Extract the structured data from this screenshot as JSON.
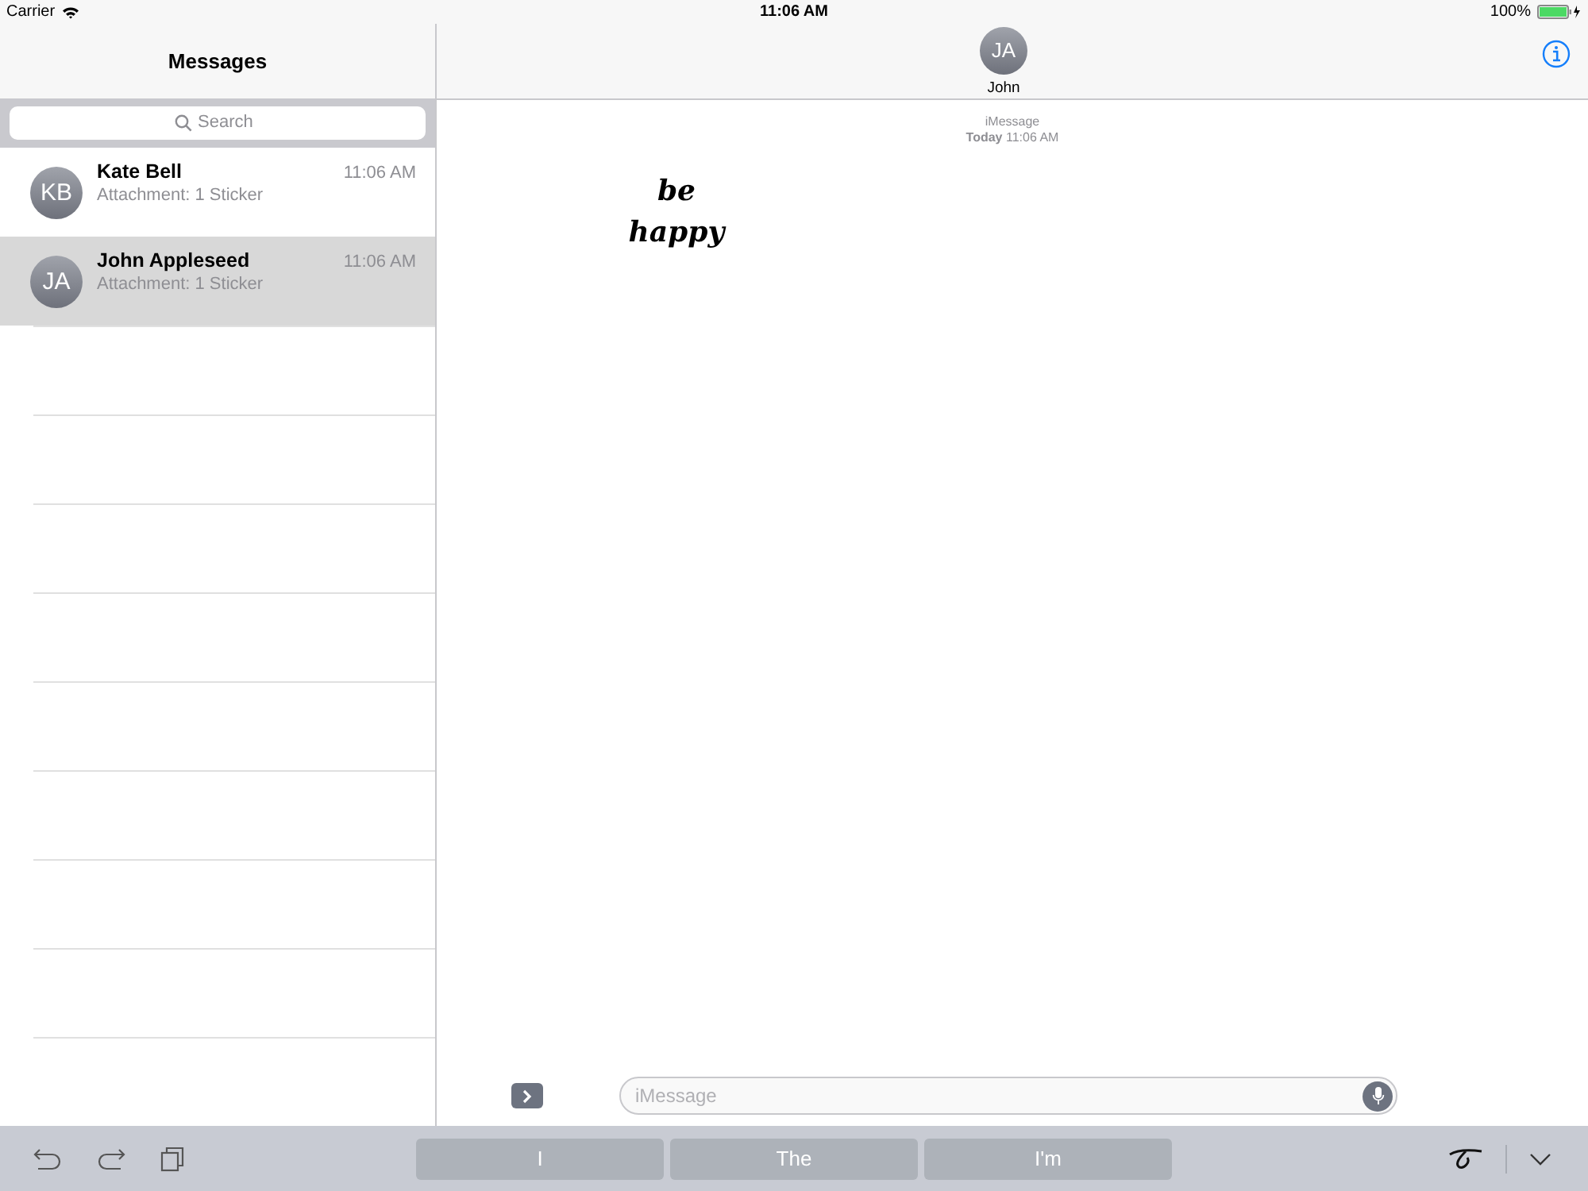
{
  "status_bar": {
    "carrier": "Carrier",
    "time": "11:06 AM",
    "battery": "100%"
  },
  "sidebar": {
    "title": "Messages",
    "search": {
      "placeholder": "Search"
    },
    "conversations": [
      {
        "initials": "KB",
        "name": "Kate Bell",
        "preview": "Attachment: 1 Sticker",
        "time": "11:06 AM",
        "selected": false
      },
      {
        "initials": "JA",
        "name": "John Appleseed",
        "preview": "Attachment: 1 Sticker",
        "time": "11:06 AM",
        "selected": true
      }
    ]
  },
  "chat": {
    "contact": {
      "initials": "JA",
      "name": "John"
    },
    "service": "iMessage",
    "date_label": "Today",
    "date_time": "11:06 AM",
    "messages": [
      {
        "kind": "sticker",
        "text": "be happy"
      }
    ],
    "compose": {
      "placeholder": "iMessage"
    }
  },
  "keyboard_bar": {
    "suggestions": [
      "I",
      "The",
      "I'm"
    ]
  }
}
